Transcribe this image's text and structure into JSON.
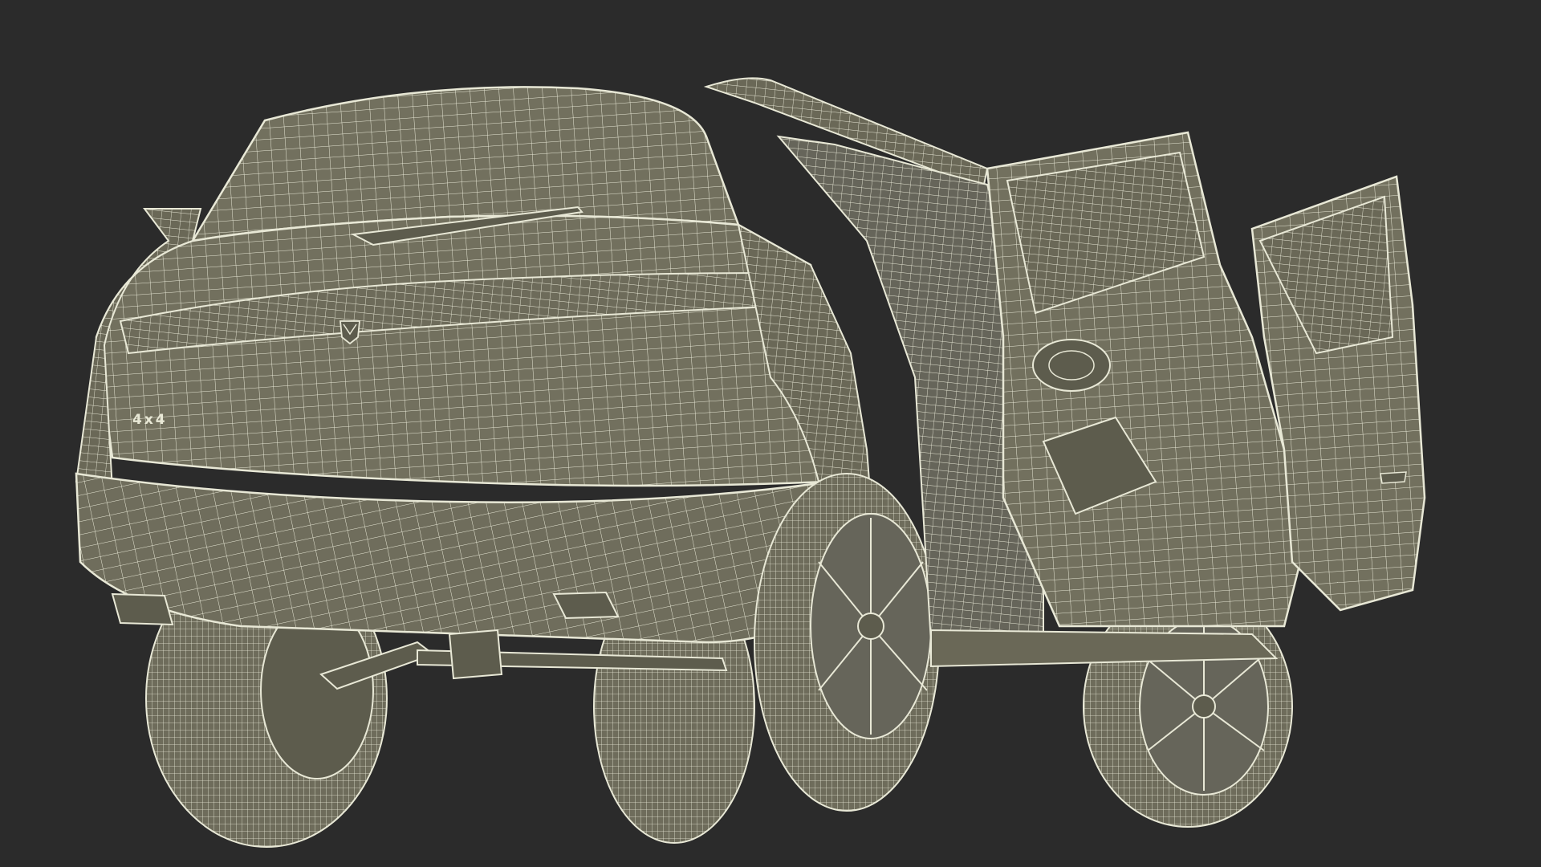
{
  "scene": {
    "background_color": "#2b2b2b",
    "body_fill_color": "#72705e",
    "shadow_fill_color": "#5d5c4d",
    "wire_color": "#e8e8d6",
    "subject": "suv-wireframe-render"
  },
  "badges": {
    "drive_badge": "4x4"
  },
  "icons": {
    "rear_emblem": "brand-emblem-icon"
  }
}
